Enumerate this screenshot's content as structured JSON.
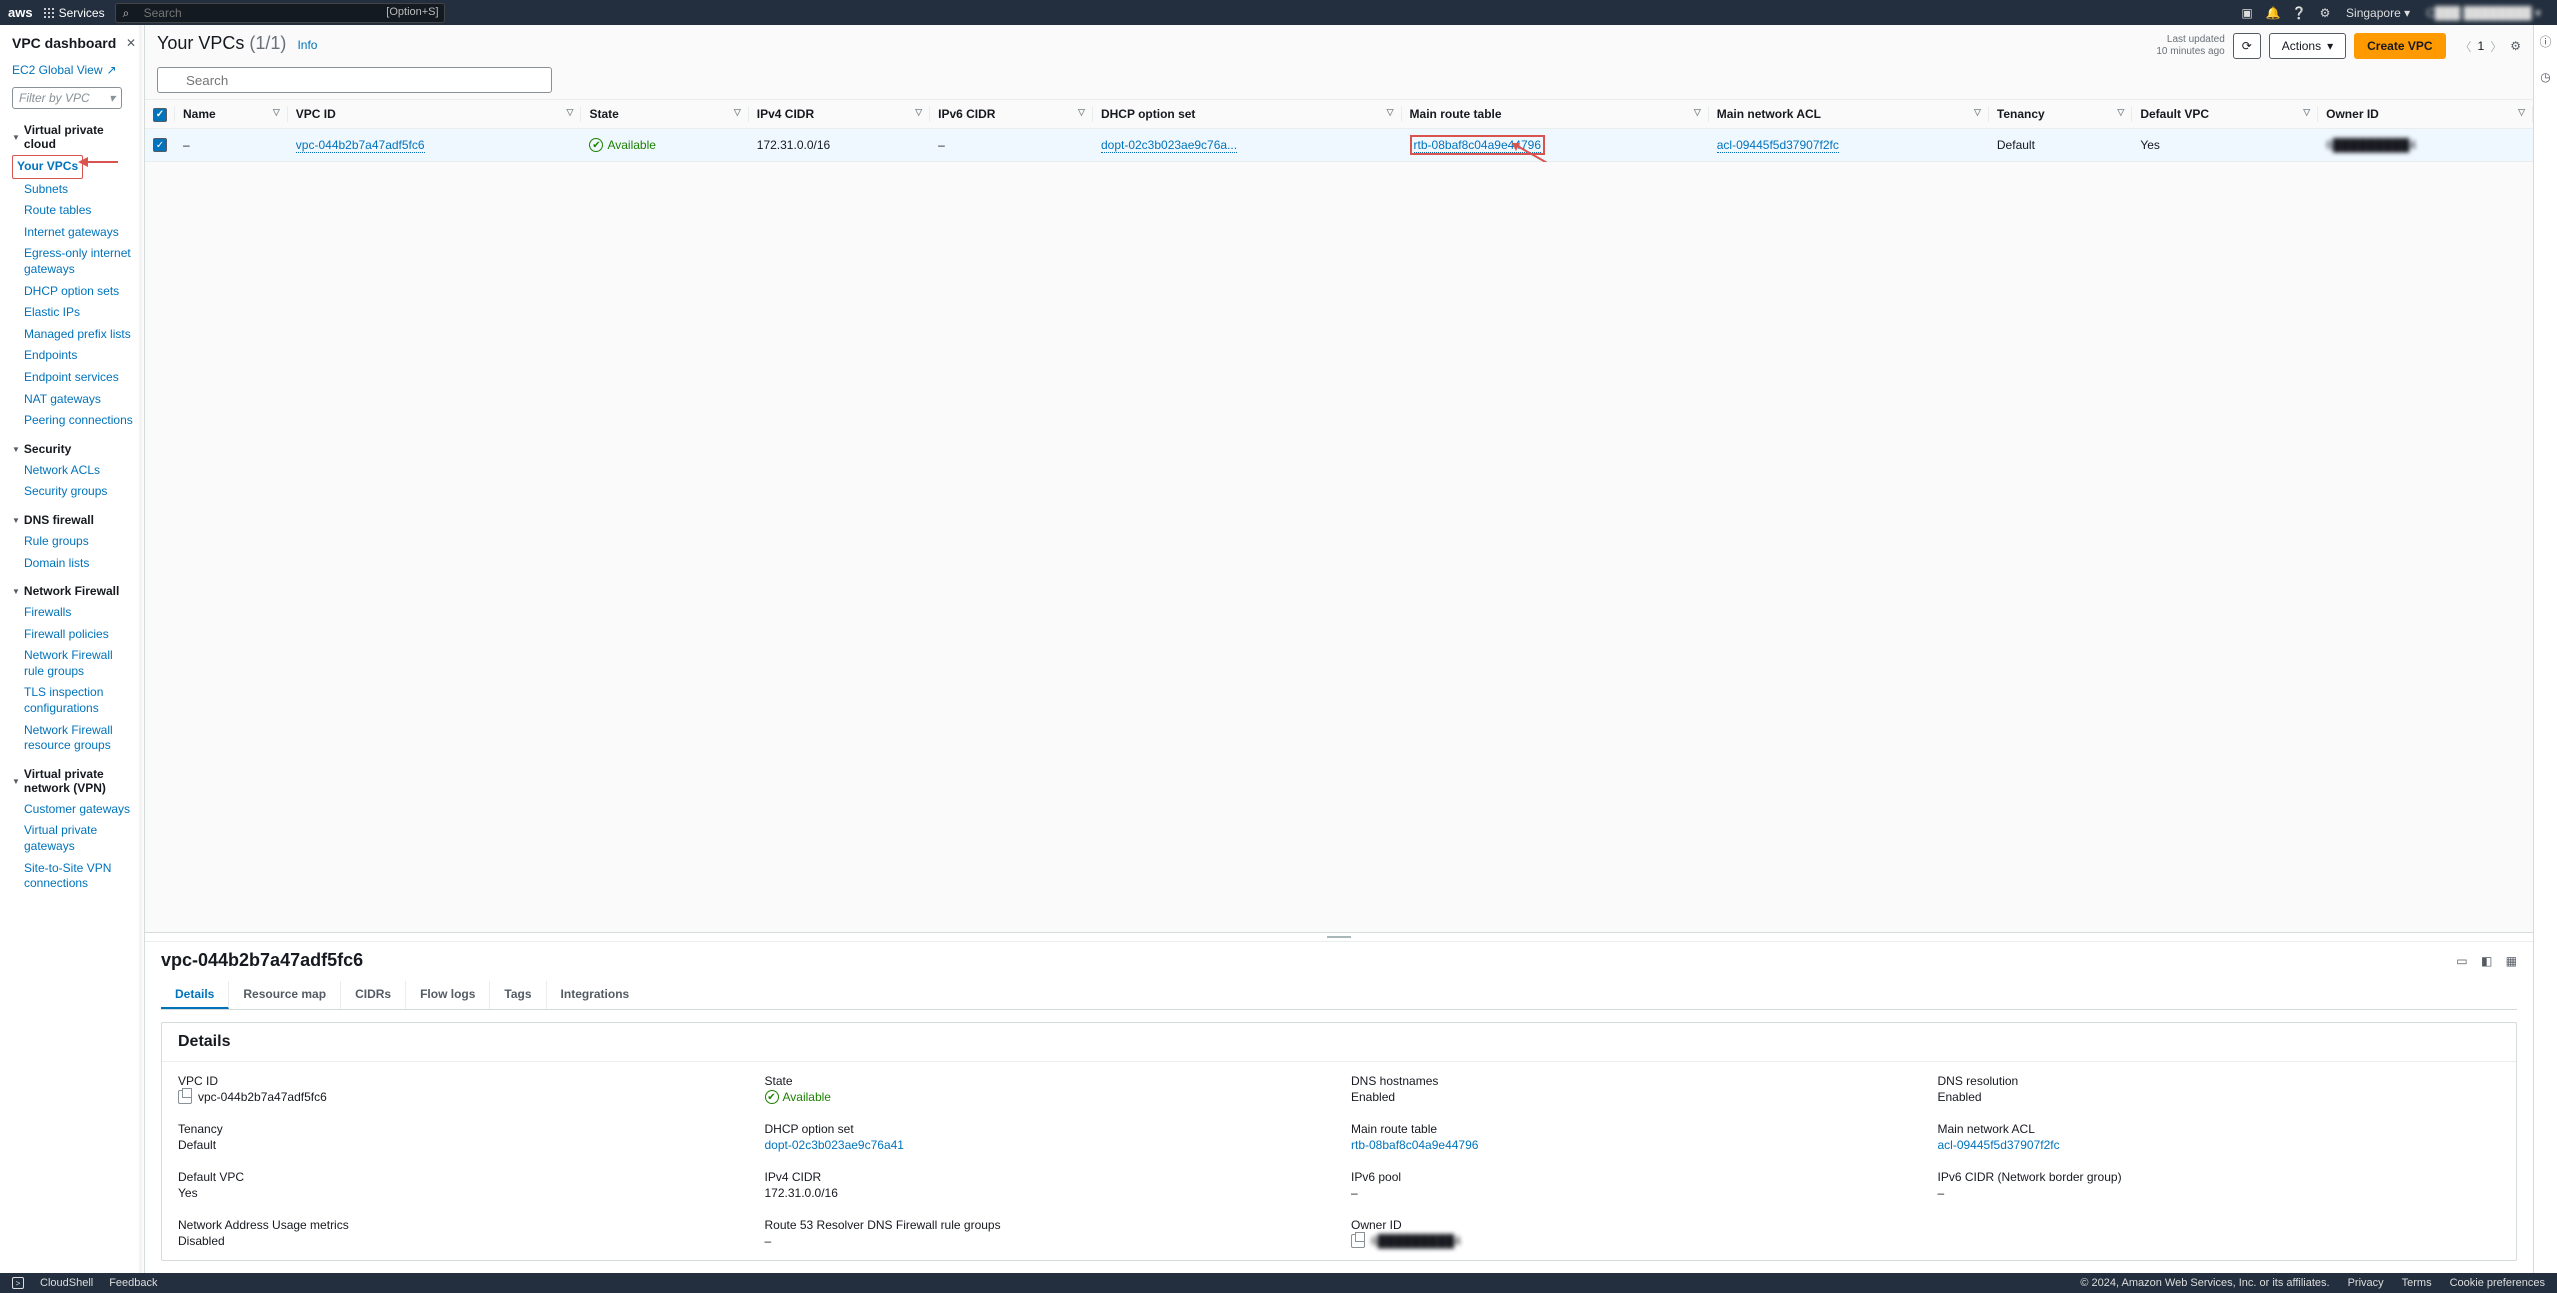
{
  "topbar": {
    "logo": "aws",
    "services": "Services",
    "search_placeholder": "Search",
    "search_kbd": "[Option+S]",
    "region": "Singapore",
    "account": "C███ ████████ ▾"
  },
  "sidebar": {
    "title": "VPC dashboard",
    "ec2_link": "EC2 Global View",
    "filter_placeholder": "Filter by VPC",
    "groups": [
      {
        "title": "Virtual private cloud",
        "items": [
          "Your VPCs",
          "Subnets",
          "Route tables",
          "Internet gateways",
          "Egress-only internet gateways",
          "DHCP option sets",
          "Elastic IPs",
          "Managed prefix lists",
          "Endpoints",
          "Endpoint services",
          "NAT gateways",
          "Peering connections"
        ],
        "active_index": 0
      },
      {
        "title": "Security",
        "items": [
          "Network ACLs",
          "Security groups"
        ]
      },
      {
        "title": "DNS firewall",
        "items": [
          "Rule groups",
          "Domain lists"
        ]
      },
      {
        "title": "Network Firewall",
        "items": [
          "Firewalls",
          "Firewall policies",
          "Network Firewall rule groups",
          "TLS inspection configurations",
          "Network Firewall resource groups"
        ]
      },
      {
        "title": "Virtual private network (VPN)",
        "items": [
          "Customer gateways",
          "Virtual private gateways",
          "Site-to-Site VPN connections"
        ]
      }
    ]
  },
  "page": {
    "title": "Your VPCs",
    "count": "(1/1)",
    "info": "Info",
    "last_updated_line1": "Last updated",
    "last_updated_line2": "10 minutes ago",
    "actions_label": "Actions",
    "create_label": "Create VPC",
    "page_num": "1",
    "search_placeholder": "Search"
  },
  "table": {
    "headers": [
      "Name",
      "VPC ID",
      "State",
      "IPv4 CIDR",
      "IPv6 CIDR",
      "DHCP option set",
      "Main route table",
      "Main network ACL",
      "Tenancy",
      "Default VPC",
      "Owner ID"
    ],
    "row": {
      "name": "–",
      "vpc_id": "vpc-044b2b7a47adf5fc6",
      "state": "Available",
      "ipv4": "172.31.0.0/16",
      "ipv6": "–",
      "dhcp": "dopt-02c3b023ae9c76a...",
      "route": "rtb-08baf8c04a9e44796",
      "acl": "acl-09445f5d37907f2fc",
      "tenancy": "Default",
      "default_vpc": "Yes",
      "owner": "6█████████4"
    }
  },
  "detail": {
    "heading": "vpc-044b2b7a47adf5fc6",
    "tabs": [
      "Details",
      "Resource map",
      "CIDRs",
      "Flow logs",
      "Tags",
      "Integrations"
    ],
    "panel_title": "Details",
    "fields": {
      "vpc_id_label": "VPC ID",
      "vpc_id": "vpc-044b2b7a47adf5fc6",
      "state_label": "State",
      "state": "Available",
      "dns_host_label": "DNS hostnames",
      "dns_host": "Enabled",
      "dns_res_label": "DNS resolution",
      "dns_res": "Enabled",
      "tenancy_label": "Tenancy",
      "tenancy": "Default",
      "dhcp_label": "DHCP option set",
      "dhcp": "dopt-02c3b023ae9c76a41",
      "route_label": "Main route table",
      "route": "rtb-08baf8c04a9e44796",
      "acl_label": "Main network ACL",
      "acl": "acl-09445f5d37907f2fc",
      "defvpc_label": "Default VPC",
      "defvpc": "Yes",
      "ipv4_label": "IPv4 CIDR",
      "ipv4": "172.31.0.0/16",
      "ipv6pool_label": "IPv6 pool",
      "ipv6pool": "–",
      "ipv6cidr_label": "IPv6 CIDR (Network border group)",
      "ipv6cidr": "–",
      "nau_label": "Network Address Usage metrics",
      "nau": "Disabled",
      "r53_label": "Route 53 Resolver DNS Firewall rule groups",
      "r53": "–",
      "owner_label": "Owner ID",
      "owner": "6█████████4"
    }
  },
  "footer": {
    "cloudshell": "CloudShell",
    "feedback": "Feedback",
    "copyright": "© 2024, Amazon Web Services, Inc. or its affiliates.",
    "privacy": "Privacy",
    "terms": "Terms",
    "cookie": "Cookie preferences"
  }
}
